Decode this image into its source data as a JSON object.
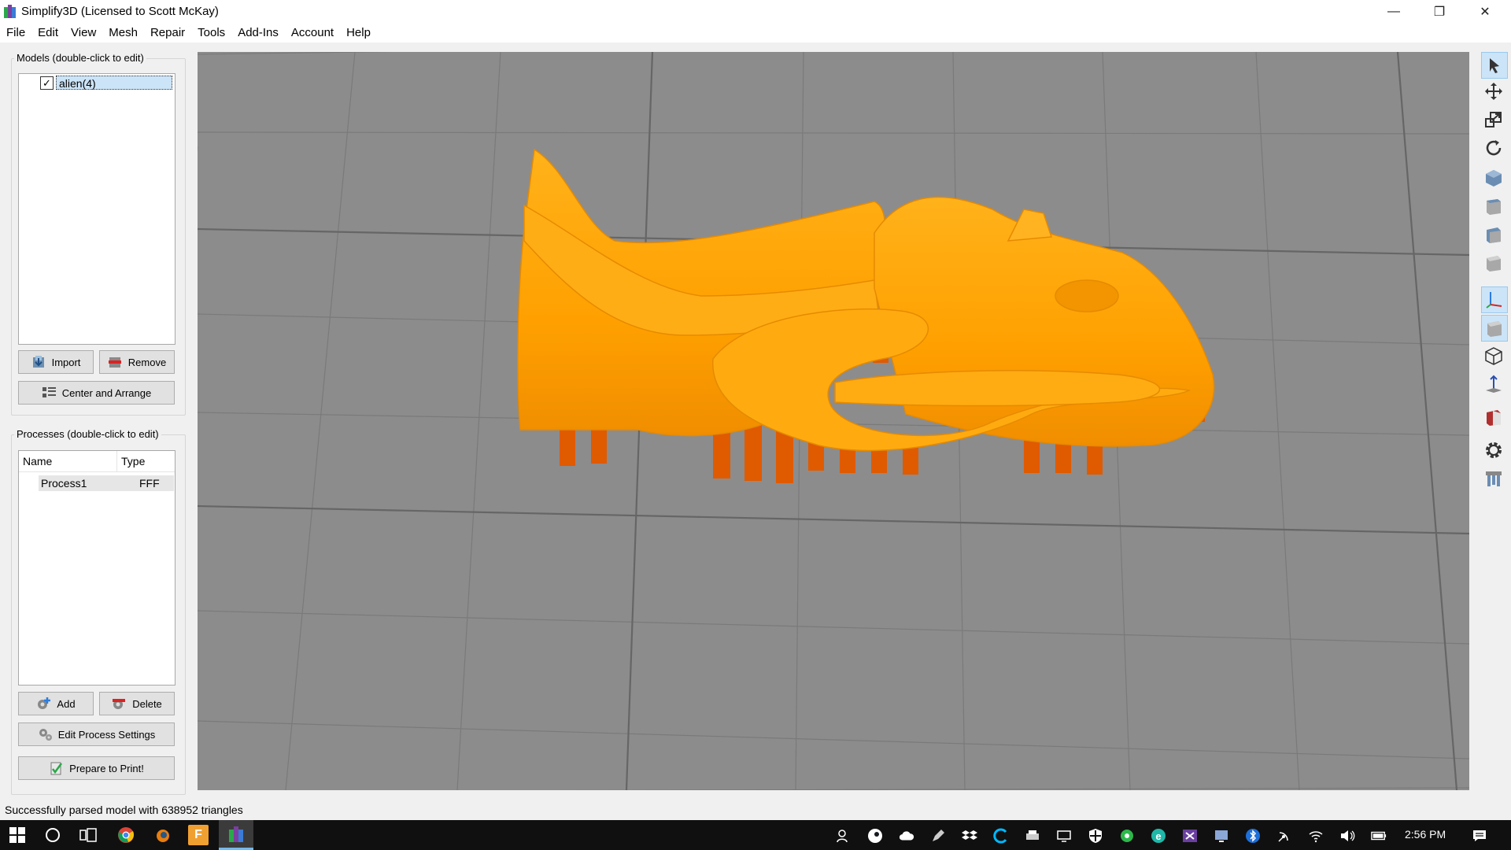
{
  "window": {
    "title": "Simplify3D (Licensed to Scott McKay)",
    "minimize_label": "—",
    "restore_label": "❐",
    "close_label": "✕"
  },
  "menubar": {
    "items": [
      "File",
      "Edit",
      "View",
      "Mesh",
      "Repair",
      "Tools",
      "Add-Ins",
      "Account",
      "Help"
    ]
  },
  "models_panel": {
    "title": "Models (double-click to edit)",
    "items": [
      {
        "label": "alien(4)",
        "checked": true,
        "selected": true
      }
    ],
    "import_label": "Import",
    "remove_label": "Remove",
    "center_arrange_label": "Center and Arrange"
  },
  "processes_panel": {
    "title": "Processes (double-click to edit)",
    "columns": [
      "Name",
      "Type"
    ],
    "rows": [
      {
        "name": "Process1",
        "type": "FFF"
      }
    ],
    "add_label": "Add",
    "delete_label": "Delete",
    "edit_settings_label": "Edit Process Settings",
    "prepare_label": "Prepare to Print!"
  },
  "viewport": {
    "background_color": "#8c8c8c",
    "model_color": "#ffa500",
    "support_color": "#e05a00"
  },
  "right_toolbar": {
    "tools": [
      "select-icon",
      "move-icon",
      "scale-icon",
      "rotate-icon",
      "view-iso-icon",
      "view-front-icon",
      "view-side-icon",
      "view-top-icon",
      "axes-icon",
      "solid-view-icon",
      "wireframe-icon",
      "normal-icon",
      "cross-section-icon",
      "settings-gear-icon",
      "supports-icon"
    ]
  },
  "statusbar": {
    "message": "Successfully parsed model with 638952 triangles"
  },
  "taskbar": {
    "clock": "2:56 PM",
    "pinned": [
      "start-icon",
      "cortana-icon",
      "task-view-icon",
      "chrome-icon",
      "blender-icon",
      "fusion-icon",
      "simplify3d-icon"
    ],
    "tray": [
      "people-icon",
      "steam-icon",
      "onedrive-icon",
      "pen-icon",
      "dropbox-icon",
      "logitech-icon",
      "printer-icon",
      "display-icon",
      "defender-icon",
      "green-app-icon",
      "edge-icon",
      "nvidia-icon",
      "monitor-icon",
      "bluetooth-icon",
      "satellite-icon",
      "wifi-icon",
      "volume-icon",
      "battery-icon",
      "notification-icon"
    ]
  }
}
